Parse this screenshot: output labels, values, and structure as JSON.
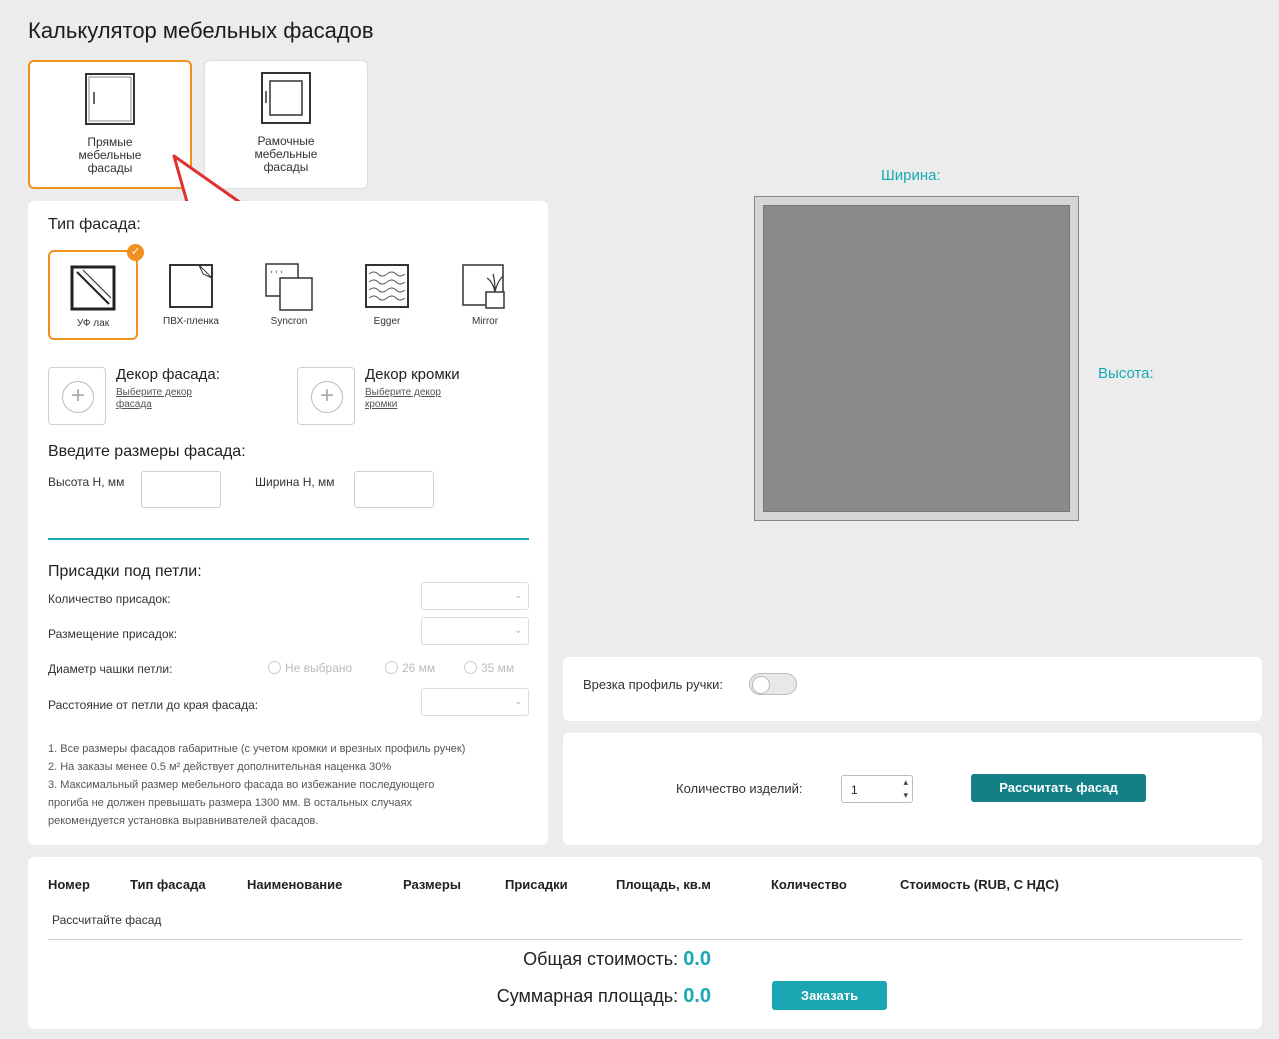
{
  "page_title": "Калькулятор мебельных фасадов",
  "facade_kinds": [
    {
      "label": "Прямые мебельные фасады",
      "selected": true
    },
    {
      "label": "Рамочные мебельные фасады",
      "selected": false
    }
  ],
  "facade_type": {
    "title": "Тип фасада:",
    "items": [
      {
        "label": "УФ лак",
        "selected": true,
        "icon": "uv-lacquer-icon"
      },
      {
        "label": "ПВХ-пленка",
        "selected": false,
        "icon": "pvc-film-icon"
      },
      {
        "label": "Syncron",
        "selected": false,
        "icon": "syncron-icon"
      },
      {
        "label": "Egger",
        "selected": false,
        "icon": "egger-icon"
      },
      {
        "label": "Mirror",
        "selected": false,
        "icon": "mirror-icon"
      }
    ],
    "check_mark": "✓"
  },
  "decor": {
    "facade_title": "Декор фасада:",
    "facade_link": "Выберите декор фасада",
    "edge_title": "Декор кромки",
    "edge_link": "Выберите декор кромки"
  },
  "sizes": {
    "title": "Введите размеры фасада:",
    "height_label": "Высота Н, мм",
    "height_value": "",
    "width_label": "Ширина Н, мм",
    "width_value": ""
  },
  "hinges": {
    "title": "Присадки под петли:",
    "count_label": "Количество присадок:",
    "placement_label": "Размещение присадок:",
    "cup_diameter_label": "Диаметр чашки петли:",
    "cup_options": [
      "Не выбрано",
      "26 мм",
      "35 мм"
    ],
    "distance_label": "Расстояние от петли до края фасада:",
    "chevron": "⌄"
  },
  "notes": [
    "1. Все размеры фасадов габаритные (с учетом кромки и врезных профиль ручек)",
    "2. На заказы менее 0.5 м² действует дополнительная наценка 30%",
    "3. Максимальный размер мебельного фасада во избежание последующего",
    "прогиба не должен превышать размера 1300 мм. В остальных случаях",
    "рекомендуется установка выравнивателей фасадов."
  ],
  "preview": {
    "width_label": "Ширина:",
    "height_label": "Высота:",
    "facade_color": "#8a8a8a"
  },
  "handle": {
    "label": "Врезка профиль ручки:",
    "enabled": false
  },
  "order": {
    "quantity_label": "Количество изделий:",
    "quantity_value": "1",
    "calc_button": "Рассчитать фасад"
  },
  "table": {
    "headers": [
      "Номер",
      "Тип фасада",
      "Наименование",
      "Размеры",
      "Присадки",
      "Площадь, кв.м",
      "Количество",
      "Стоимость (RUB, С НДС)"
    ],
    "empty_text": "Рассчитайте фасад"
  },
  "totals": {
    "cost_label": "Общая стоимость:",
    "cost_value": "0.0",
    "area_label": "Суммарная площадь:",
    "area_value": "0.0",
    "order_button": "Заказать"
  },
  "colors": {
    "accent_orange": "#f0901e",
    "teal": "#1aa8b4",
    "button_teal": "#157f88"
  }
}
